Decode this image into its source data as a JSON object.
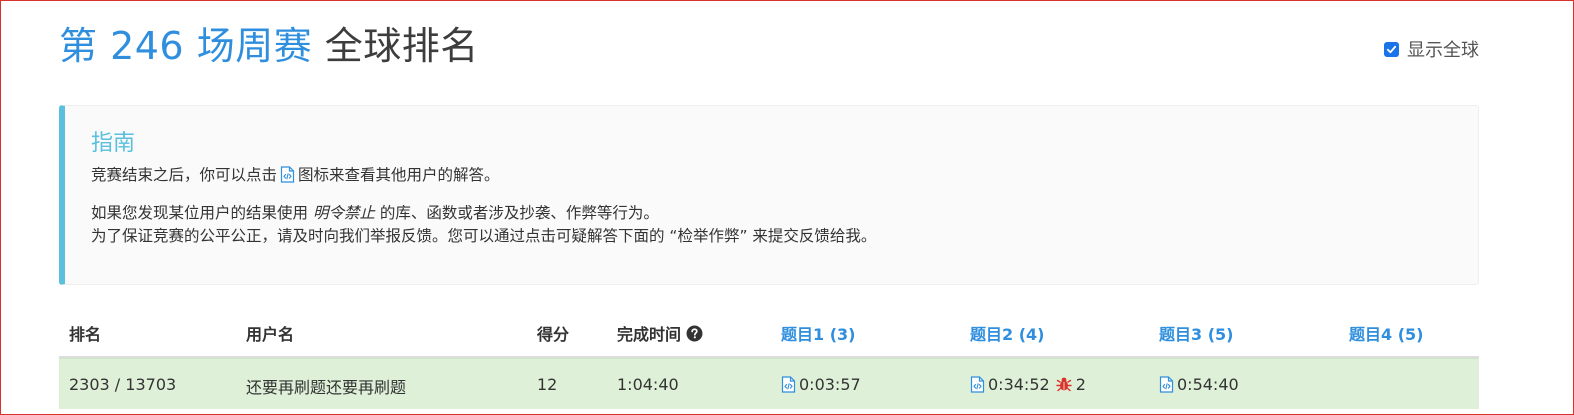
{
  "header": {
    "contest_title": "第 246 场周赛",
    "title_suffix": "全球排名",
    "show_global_label": "显示全球",
    "show_global_checked": true
  },
  "guide": {
    "title": "指南",
    "line1_before_icon": "竞赛结束之后，你可以点击",
    "line1_after_icon": "图标来查看其他用户的解答。",
    "line2_before": "如果您发现某位用户的结果使用",
    "line2_emphasis": "明令禁止",
    "line2_after": "的库、函数或者涉及抄袭、作弊等行为。",
    "line3": "为了保证竞赛的公平公正，请及时向我们举报反馈。您可以通过点击可疑解答下面的 “检举作弊” 来提交反馈给我。"
  },
  "table": {
    "headers": {
      "rank": "排名",
      "username": "用户名",
      "score": "得分",
      "finish_time": "完成时间",
      "q1": "题目1 (3)",
      "q2": "题目2 (4)",
      "q3": "题目3 (5)",
      "q4": "题目4 (5)"
    },
    "rows": [
      {
        "rank": "2303 / 13703",
        "username": "还要再刷题还要再刷题",
        "score": "12",
        "finish_time": "1:04:40",
        "q1_time": "0:03:57",
        "q2_time": "0:34:52",
        "q2_bugs": "2",
        "q3_time": "0:54:40",
        "q4_time": ""
      }
    ]
  },
  "colors": {
    "accent": "#2f8fde",
    "guide_accent": "#5bc0de",
    "row_highlight": "#dff0d8",
    "bug": "#d9312b"
  },
  "icons": {
    "solution": "code-file-icon",
    "help": "question-circle-icon",
    "bug": "bug-icon",
    "checkbox": "checkbox-checked-icon"
  }
}
